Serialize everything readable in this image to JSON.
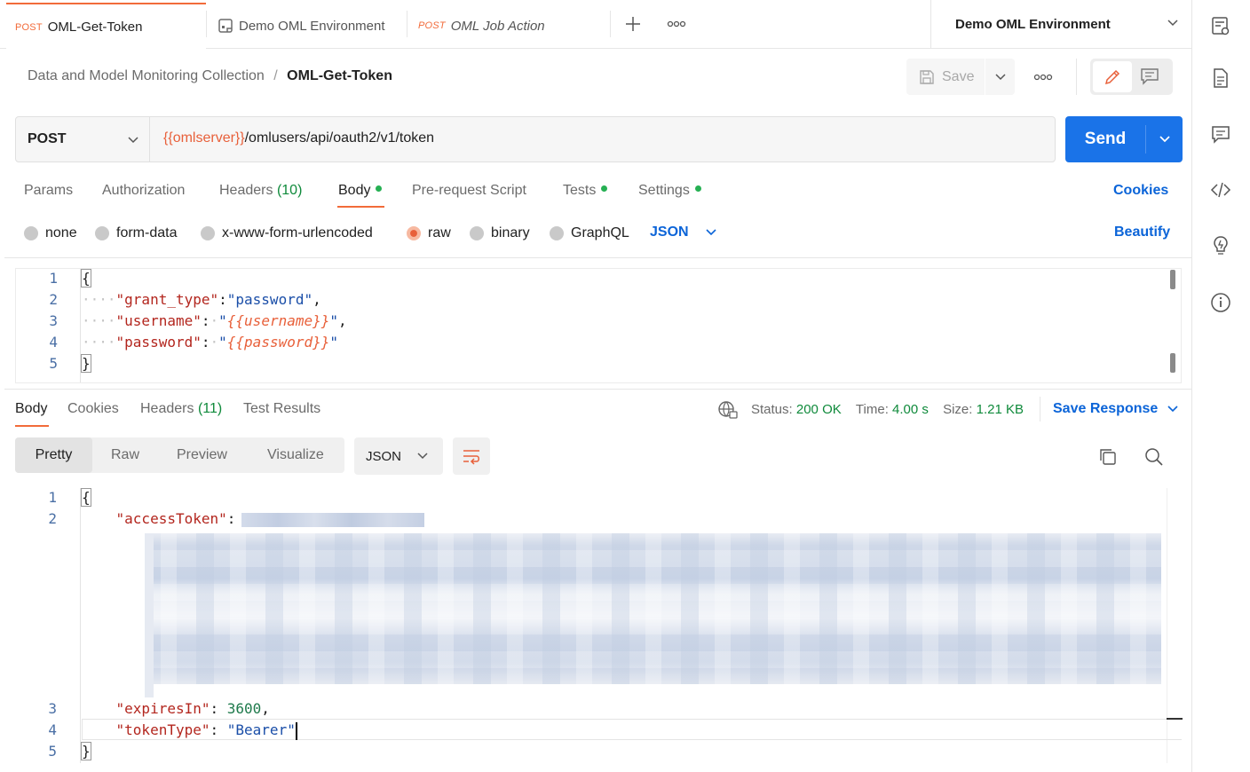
{
  "tabs": [
    {
      "method": "POST",
      "label": "OML-Get-Token",
      "active": true
    },
    {
      "method": "",
      "label": "Demo OML Environment",
      "icon": "environment-icon",
      "active": false
    },
    {
      "method": "POST",
      "label": "OML Job Action",
      "italic": true,
      "active": false
    }
  ],
  "environment": {
    "selected": "Demo OML Environment"
  },
  "breadcrumb": {
    "collection": "Data and Model Monitoring Collection",
    "separator": "/",
    "request": "OML-Get-Token"
  },
  "toolbar": {
    "save_label": "Save"
  },
  "request": {
    "method": "POST",
    "url_variable": "{{omlserver}}",
    "url_path": "/omlusers/api/oauth2/v1/token",
    "send_label": "Send"
  },
  "request_tabs": [
    {
      "label": "Params"
    },
    {
      "label": "Authorization"
    },
    {
      "label": "Headers",
      "count": "(10)"
    },
    {
      "label": "Body",
      "dot": true,
      "active": true
    },
    {
      "label": "Pre-request Script"
    },
    {
      "label": "Tests",
      "dot": true
    },
    {
      "label": "Settings",
      "dot": true
    }
  ],
  "cookies_label": "Cookies",
  "body_modes": [
    {
      "label": "none",
      "selected": false
    },
    {
      "label": "form-data",
      "selected": false
    },
    {
      "label": "x-www-form-urlencoded",
      "selected": false
    },
    {
      "label": "raw",
      "selected": true
    },
    {
      "label": "binary",
      "selected": false
    },
    {
      "label": "GraphQL",
      "selected": false
    }
  ],
  "body_format": "JSON",
  "beautify_label": "Beautify",
  "request_body": {
    "line_numbers": [
      "1",
      "2",
      "3",
      "4",
      "5"
    ],
    "open_brace": "{",
    "close_brace": "}",
    "grant_type_key": "\"grant_type\"",
    "grant_type_value": "\"password\"",
    "username_key": "\"username\"",
    "username_value": "{{username}}",
    "password_key": "\"password\"",
    "password_value": "{{password}}"
  },
  "response_tabs": [
    {
      "label": "Body",
      "active": true
    },
    {
      "label": "Cookies"
    },
    {
      "label": "Headers",
      "count": "(11)"
    },
    {
      "label": "Test Results"
    }
  ],
  "response_status": {
    "status_label": "Status:",
    "status_value": "200 OK",
    "time_label": "Time:",
    "time_value": "4.00 s",
    "size_label": "Size:",
    "size_value": "1.21 KB"
  },
  "save_response_label": "Save Response",
  "view_modes": [
    {
      "label": "Pretty",
      "active": true
    },
    {
      "label": "Raw"
    },
    {
      "label": "Preview"
    },
    {
      "label": "Visualize"
    }
  ],
  "response_format": "JSON",
  "response_body": {
    "line_numbers": [
      "1",
      "2",
      "3",
      "4",
      "5"
    ],
    "open_brace": "{",
    "close_brace": "}",
    "access_token_key": "\"accessToken\"",
    "expires_in_key": "\"expiresIn\"",
    "expires_in_value": "3600",
    "token_type_key": "\"tokenType\"",
    "token_type_value": "\"Bearer\""
  },
  "colors": {
    "accent_orange": "#f26b3a",
    "send_blue": "#1a73e8",
    "link_blue": "#0b64d8",
    "status_green": "#0f8a3b",
    "redacted_blue": "#c8d3e6"
  }
}
